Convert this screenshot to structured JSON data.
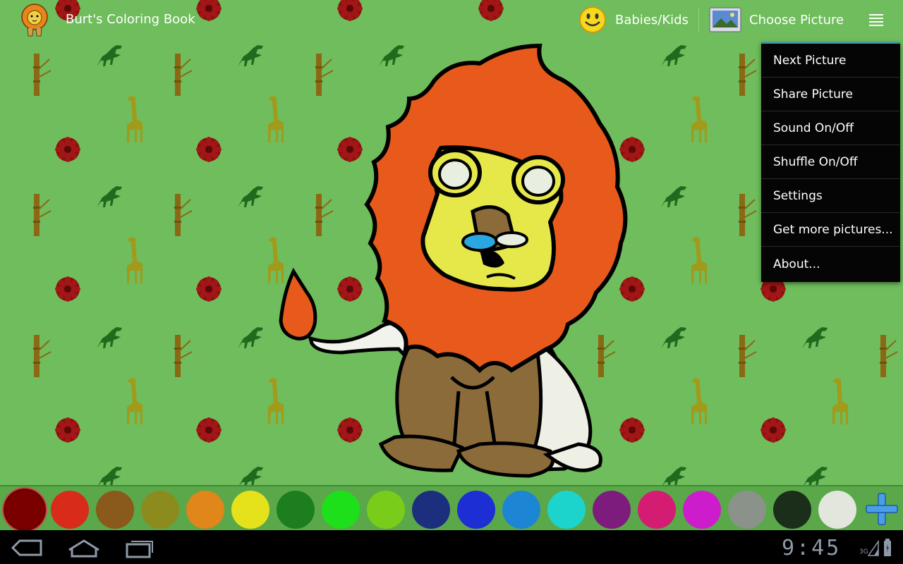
{
  "action_bar": {
    "app_title": "Burt's Coloring Book",
    "category_label": "Babies/Kids",
    "choose_label": "Choose Picture"
  },
  "menu": {
    "items": [
      "Next Picture",
      "Share Picture",
      "Sound On/Off",
      "Shuffle On/Off",
      "Settings",
      "Get more pictures...",
      "About..."
    ]
  },
  "palette": {
    "colors": [
      "#7a0000",
      "#d92b1a",
      "#8a5a1c",
      "#8c8c1e",
      "#e0861a",
      "#e5e21c",
      "#1c7e1c",
      "#1ee01a",
      "#7acc1a",
      "#1c2e7e",
      "#1c2ed4",
      "#1c86d4",
      "#1cd4cc",
      "#7e1c7e",
      "#d41c72",
      "#cc1ccc",
      "#8a928a",
      "#1a2e1a",
      "#e2e6dc"
    ],
    "selected_index": 0
  },
  "status_bar": {
    "time": "9:45",
    "network": "3G"
  },
  "icons": {
    "app": "lion-icon",
    "category": "smiley-icon",
    "choose": "picture-icon",
    "overflow": "overflow-menu-icon",
    "add_color": "plus-icon",
    "back": "back-icon",
    "home": "home-icon",
    "recents": "recent-apps-icon"
  }
}
